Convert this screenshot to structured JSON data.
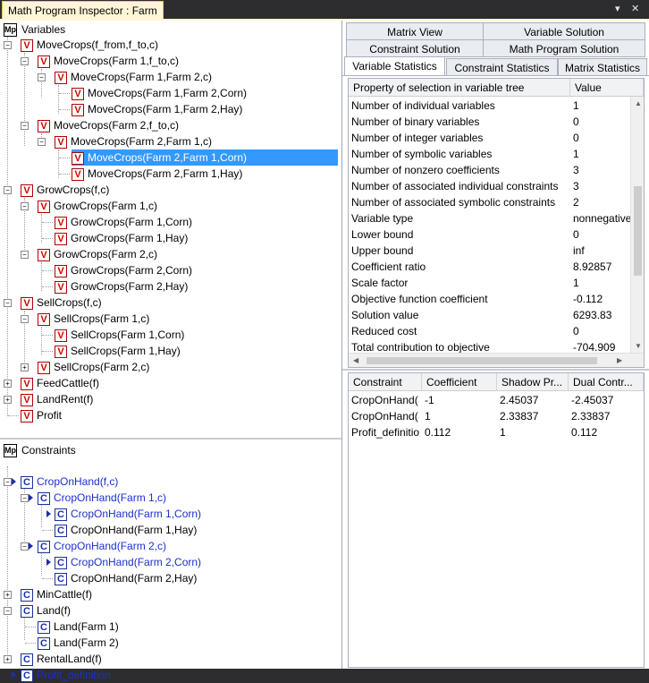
{
  "title": "Math Program Inspector : Farm",
  "window_controls": {
    "pin": "▾",
    "close": "✕"
  },
  "variables_tree": {
    "root_label": "Variables",
    "root_icon": "Mp",
    "icon_letter": "V",
    "items": [
      "MoveCrops(f_from,f_to,c)",
      "MoveCrops(Farm 1,f_to,c)",
      "MoveCrops(Farm 1,Farm 2,c)",
      "MoveCrops(Farm 1,Farm 2,Corn)",
      "MoveCrops(Farm 1,Farm 2,Hay)",
      "MoveCrops(Farm 2,f_to,c)",
      "MoveCrops(Farm 2,Farm 1,c)",
      "MoveCrops(Farm 2,Farm 1,Corn)",
      "MoveCrops(Farm 2,Farm 1,Hay)",
      "GrowCrops(f,c)",
      "GrowCrops(Farm 1,c)",
      "GrowCrops(Farm 1,Corn)",
      "GrowCrops(Farm 1,Hay)",
      "GrowCrops(Farm 2,c)",
      "GrowCrops(Farm 2,Corn)",
      "GrowCrops(Farm 2,Hay)",
      "SellCrops(f,c)",
      "SellCrops(Farm 1,c)",
      "SellCrops(Farm 1,Corn)",
      "SellCrops(Farm 1,Hay)",
      "SellCrops(Farm 2,c)",
      "FeedCattle(f)",
      "LandRent(f)",
      "Profit"
    ],
    "selected_index": 7
  },
  "constraints_tree": {
    "root_label": "Constraints",
    "root_icon": "Mp",
    "icon_letter": "C",
    "items": [
      "CropOnHand(f,c)",
      "CropOnHand(Farm 1,c)",
      "CropOnHand(Farm 1,Corn)",
      "CropOnHand(Farm 1,Hay)",
      "CropOnHand(Farm 2,c)",
      "CropOnHand(Farm 2,Corn)",
      "CropOnHand(Farm 2,Hay)",
      "MinCattle(f)",
      "Land(f)",
      "Land(Farm 1)",
      "Land(Farm 2)",
      "RentalLand(f)",
      "Profit_definition"
    ]
  },
  "tabs": {
    "row1": [
      "Matrix View",
      "Variable Solution"
    ],
    "row2": [
      "Constraint Solution",
      "Math Program Solution"
    ],
    "row3": [
      "Variable Statistics",
      "Constraint Statistics",
      "Matrix Statistics"
    ],
    "active": "Variable Statistics"
  },
  "stats_grid": {
    "headers": [
      "Property of selection in variable tree",
      "Value"
    ],
    "rows": [
      [
        "Number of individual variables",
        "1"
      ],
      [
        "Number of binary variables",
        "0"
      ],
      [
        "Number of integer variables",
        "0"
      ],
      [
        "Number of symbolic variables",
        "1"
      ],
      [
        "Number of nonzero coefficients",
        "3"
      ],
      [
        "Number of associated individual constraints",
        "3"
      ],
      [
        "Number of associated symbolic constraints",
        "2"
      ],
      [
        "Variable type",
        "nonnegative"
      ],
      [
        "Lower bound",
        "0"
      ],
      [
        "Upper bound",
        "inf"
      ],
      [
        "Coefficient ratio",
        "8.92857"
      ],
      [
        "Scale factor",
        "1"
      ],
      [
        "Objective function coefficient",
        "-0.112"
      ],
      [
        "Solution value",
        "6293.83"
      ],
      [
        "Reduced cost",
        "0"
      ],
      [
        "Total contribution to objective",
        "-704.909"
      ]
    ]
  },
  "constraint_grid": {
    "headers": [
      "Constraint",
      "Coefficient",
      "Shadow Pr...",
      "Dual Contr..."
    ],
    "rows": [
      [
        "CropOnHand(",
        "-1",
        "2.45037",
        "-2.45037"
      ],
      [
        "CropOnHand(",
        "1",
        "2.33837",
        "2.33837"
      ],
      [
        "Profit_definitio",
        "0.112",
        "1",
        "0.112"
      ]
    ]
  },
  "colors": {
    "title_tab": "#fff6d6",
    "selection": "#3399ff",
    "variable_icon": "#d00000",
    "constraint_icon": "#1a2fb0",
    "link_text": "#1a2fd0"
  }
}
